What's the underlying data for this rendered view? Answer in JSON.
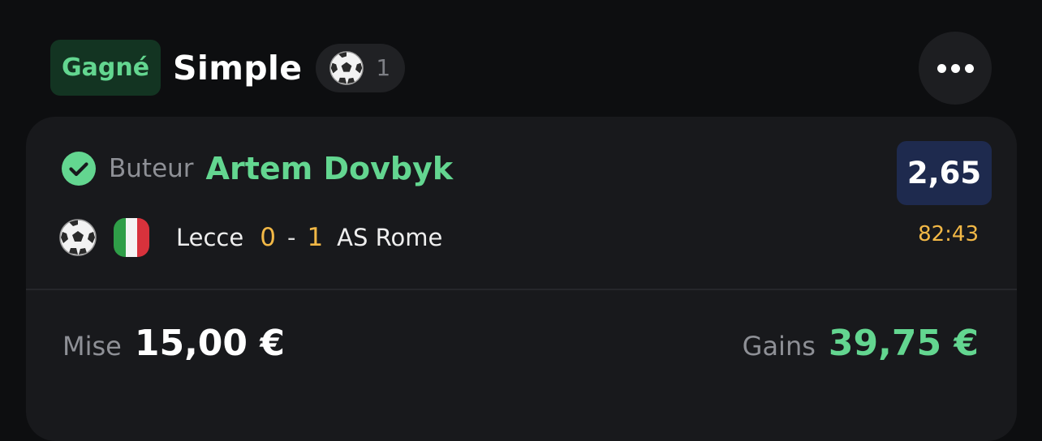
{
  "header": {
    "status": "Gagné",
    "bet_type": "Simple",
    "sport_icon": "soccer-ball-icon",
    "selection_count": "1",
    "more_icon": "more-horizontal-icon"
  },
  "selection": {
    "status_icon": "check-circle-icon",
    "market": "Buteur",
    "player": "Artem Dovbyk",
    "odds": "2,65"
  },
  "match": {
    "sport_icon": "soccer-ball-icon",
    "country_flag": "italy-flag-icon",
    "home_team": "Lecce",
    "home_score": "0",
    "separator": "-",
    "away_score": "1",
    "away_team": "AS Rome",
    "time": "82:43"
  },
  "summary": {
    "stake_label": "Mise",
    "stake_value": "15,00 €",
    "gains_label": "Gains",
    "gains_value": "39,75 €"
  },
  "colors": {
    "win_green": "#63d690",
    "score_yellow": "#f2b846",
    "odds_bg": "#1e2a4e",
    "card_bg": "#18191c",
    "page_bg": "#0d0e10"
  }
}
